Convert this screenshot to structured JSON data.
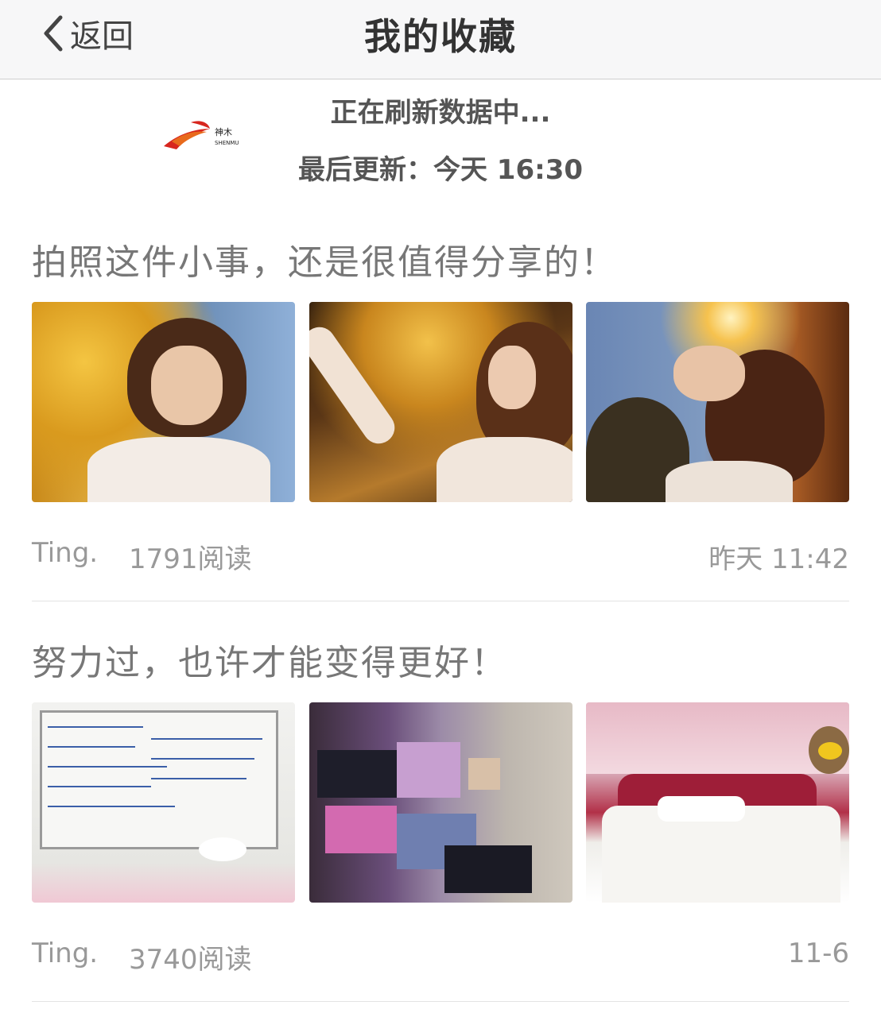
{
  "navbar": {
    "back_label": "返回",
    "title": "我的收藏"
  },
  "refresh": {
    "status": "正在刷新数据中...",
    "last_update_label": "最后更新：",
    "last_update_time": "今天 16:30",
    "logo_text": "神木",
    "logo_sub": "SHENMU"
  },
  "posts": [
    {
      "title": "拍照这件小事，还是很值得分享的！",
      "author": "Ting.",
      "reads": "1791阅读",
      "time": "昨天 11:42",
      "thumbnails": [
        "portrait-under-yellow-tree",
        "reaching-for-yellow-leaves",
        "looking-up-at-sunlight"
      ]
    },
    {
      "title": "努力过，也许才能变得更好！",
      "author": "Ting.",
      "reads": "3740阅读",
      "time": "11-6",
      "thumbnails": [
        "whiteboard-notes",
        "socks-market-stall",
        "bed-with-pink-canopy"
      ]
    }
  ],
  "colors": {
    "navbar_bg": "#f7f7f8",
    "title_text": "#777777",
    "meta_text": "#999999",
    "logo_red": "#d7261e"
  }
}
